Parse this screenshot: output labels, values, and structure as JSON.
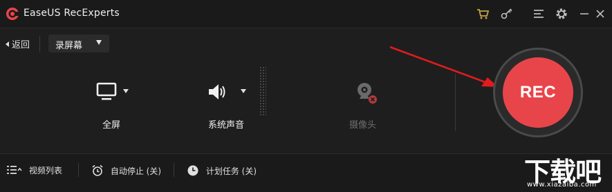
{
  "app": {
    "title": "EaseUS RecExperts",
    "brand_color": "#e8454a"
  },
  "titlebar": {
    "icons": [
      "cart-icon",
      "key-icon",
      "menu-icon",
      "gear-icon",
      "minimize-icon",
      "close-icon"
    ]
  },
  "nav": {
    "back_label": "返回",
    "mode_label": "录屏幕"
  },
  "sources": {
    "screen_label": "全屏",
    "audio_label": "系统声音",
    "webcam_label": "摄像头"
  },
  "rec": {
    "label": "REC",
    "color": "#e8454a"
  },
  "bottom": {
    "video_list": "视频列表",
    "auto_stop": "自动停止 (关)",
    "schedule": "计划任务 (关)"
  },
  "watermark": {
    "text": "下载吧",
    "url": "www.xiazaiba.com"
  }
}
